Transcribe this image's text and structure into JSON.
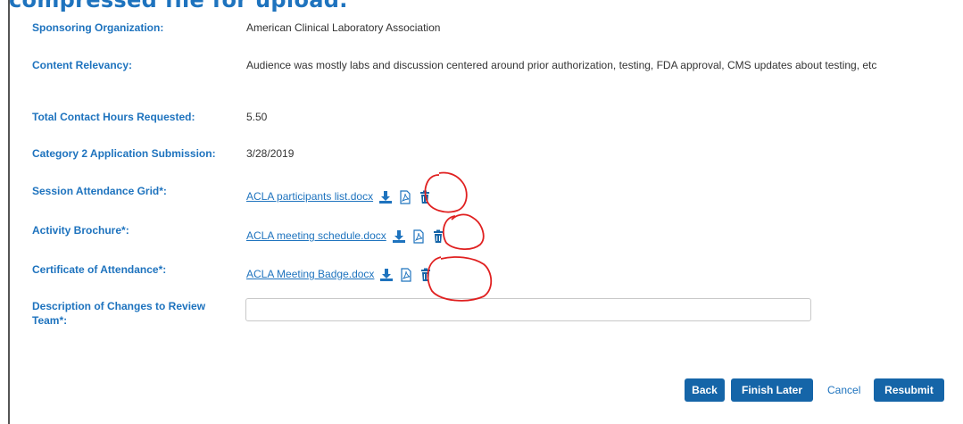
{
  "header": {
    "clipped_title": "compressed file for upload."
  },
  "fields": [
    {
      "label": "Sponsoring Organization:",
      "value": "American Clinical Laboratory Association"
    },
    {
      "label": "Content Relevancy:",
      "value": "Audience was mostly labs and discussion centered around prior authorization, testing, FDA approval, CMS updates about testing, etc"
    },
    {
      "label": "Total Contact Hours Requested:",
      "value": "5.50"
    },
    {
      "label": "Category 2 Application Submission:",
      "value": "3/28/2019"
    }
  ],
  "uploads": [
    {
      "label": "Session Attendance Grid*:",
      "file": "ACLA participants list.docx"
    },
    {
      "label": "Activity Brochure*:",
      "file": "ACLA meeting schedule.docx"
    },
    {
      "label": "Certificate of Attendance*:",
      "file": "ACLA Meeting Badge.docx"
    }
  ],
  "description": {
    "label": "Description of Changes to Review Team*:",
    "value": ""
  },
  "buttons": {
    "back": "Back",
    "finish_later": "Finish Later",
    "cancel": "Cancel",
    "resubmit": "Resubmit"
  },
  "colors": {
    "label": "#1e73be",
    "button": "#1565a8",
    "annotation": "#e02020"
  },
  "icons": {
    "download": "download-icon",
    "pdf": "pdf-icon",
    "delete": "trash-icon"
  }
}
